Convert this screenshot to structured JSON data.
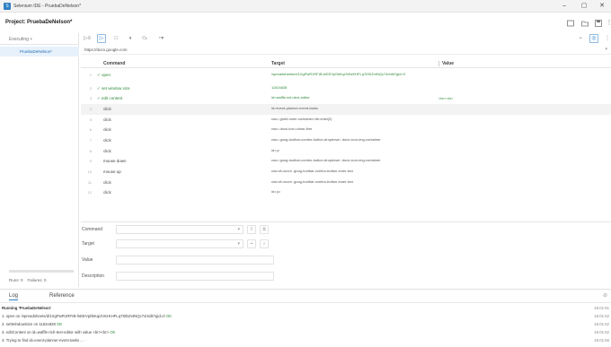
{
  "window": {
    "title": "Selenium IDE - PruebaDeNelson*",
    "minimize": "–",
    "maximize": "▢",
    "close": "✕"
  },
  "project": {
    "label": "Project: PruebaDeNelson*"
  },
  "sidebar": {
    "executing_label": "Executing",
    "tests": [
      {
        "name": "PruebaDeNelson*"
      }
    ],
    "runs_label": "Runs: 0",
    "failures_label": "Failures: 0"
  },
  "url_bar": {
    "value": "https://docs.google.com"
  },
  "table": {
    "headers": {
      "command": "Command",
      "target": "Target",
      "value": "Value"
    },
    "rows": [
      {
        "index": "1",
        "command": "open",
        "target": "/spreadsheets/d/1XgPwR1RFrB-lnEEVp0bKqiJV6zKHFLq7I0DZvtNQc74/edit?gid=0",
        "value": "",
        "status": "ok"
      },
      {
        "index": "2",
        "command": "set window size",
        "target": "1152x828",
        "value": "",
        "status": "ok"
      },
      {
        "index": "3",
        "command": "edit content",
        "target": "id=waffle-rich-text-editor",
        "value": "<br><br>",
        "status": "ok"
      },
      {
        "index": "4",
        "command": "click",
        "target": "id=event-planner-event-tasks",
        "value": "",
        "status": "selected"
      },
      {
        "index": "5",
        "command": "click",
        "target": "css=.grid4-inner-container:nth-child(2)",
        "value": "",
        "status": ""
      },
      {
        "index": "6",
        "command": "click",
        "target": "css=.docs-icon-close-thm",
        "value": "",
        "status": ""
      },
      {
        "index": "7",
        "command": "click",
        "target": "css=.goog-toolbar-combo-button-dropdown .docs-icon-img-container",
        "value": "",
        "status": ""
      },
      {
        "index": "8",
        "command": "click",
        "target": "id=:p",
        "value": "",
        "status": ""
      },
      {
        "index": "9",
        "command": "mouse down",
        "target": "css=.goog-toolbar-combo-button-dropdown .docs-icon-img-container",
        "value": "",
        "status": ""
      },
      {
        "index": "10",
        "command": "mouse up",
        "target": "css=#t-zoom .goog-toolbar-combo-button-inner-box",
        "value": "",
        "status": ""
      },
      {
        "index": "11",
        "command": "click",
        "target": "css=#t-zoom .goog-toolbar-combo-button-inner-box",
        "value": "",
        "status": ""
      },
      {
        "index": "12",
        "command": "click",
        "target": "id=:jo",
        "value": "",
        "status": ""
      }
    ]
  },
  "editor": {
    "command_label": "Command",
    "target_label": "Target",
    "value_label": "Value",
    "description_label": "Description"
  },
  "log": {
    "tabs": [
      "Log",
      "Reference"
    ],
    "lines": [
      {
        "text": "Running 'PruebaDeNelson'",
        "ok": "",
        "time": "16:01:51",
        "bold": true
      },
      {
        "text": "1.  open on /spreadsheets/d/1XgPwR1RFrB-lnEEVp0bKqiJV6zKHFLq7I0DZvtNQc74/edit?gid=0",
        "ok": "OK",
        "time": "16:01:52",
        "bold": false
      },
      {
        "text": "2.  setWindowSize on 1152x828",
        "ok": "OK",
        "time": "16:01:52",
        "bold": false
      },
      {
        "text": "3.  editContent on id=waffle-rich-text-editor with value <br><br>",
        "ok": "OK",
        "time": "16:01:52",
        "bold": false
      },
      {
        "text": "4.  Trying to find id=event-planner-event-tasks ...",
        "ok": "",
        "time": "16:01:56",
        "bold": false
      }
    ]
  },
  "colors": {
    "accent": "#2f7fc4",
    "success": "#2e8a3a",
    "selected_row": "#f3f3f3"
  }
}
